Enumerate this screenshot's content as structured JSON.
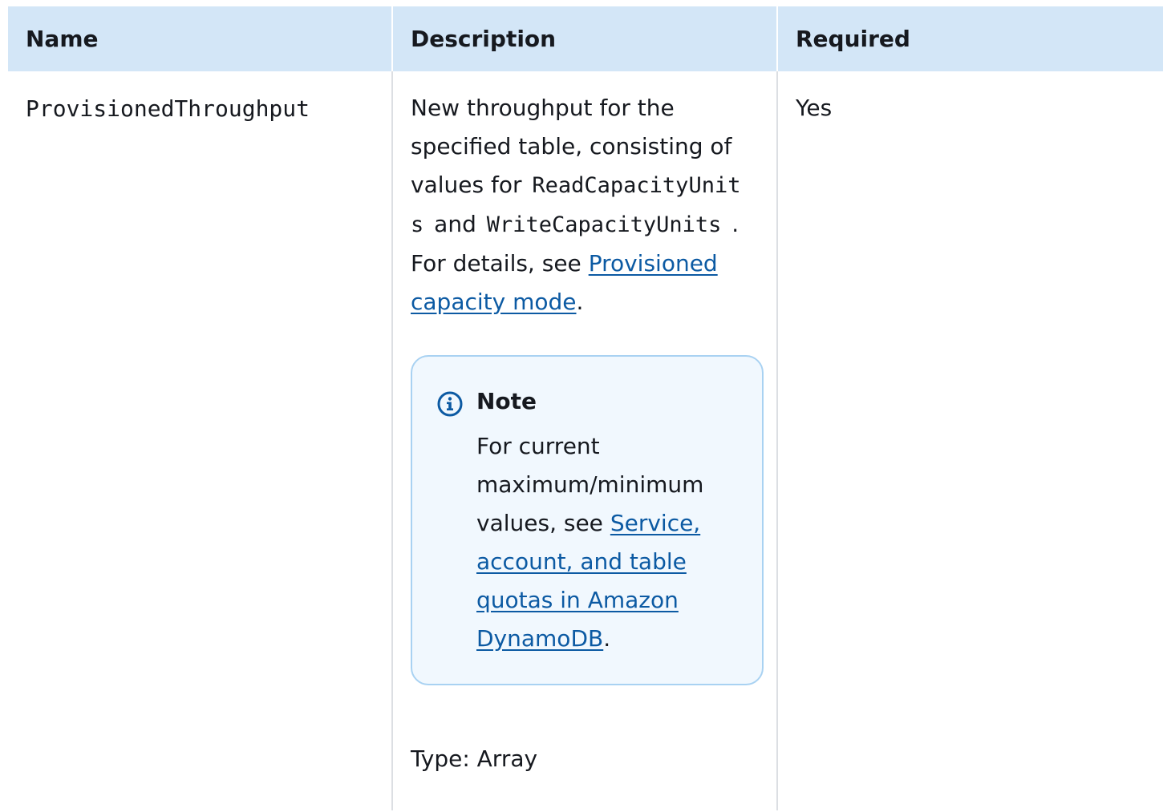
{
  "table": {
    "headers": {
      "name": "Name",
      "description": "Description",
      "required": "Required"
    },
    "row": {
      "name": "ProvisionedThroughput",
      "description": {
        "text1": "New throughput for the specified table, consisting of values for",
        "code1": "ReadCapacityUnits",
        "text2": "and",
        "code2": "WriteCapacityUnits",
        "text3": ". For details, see",
        "link1": "Provisioned capacity mode",
        "text4": "."
      },
      "note": {
        "icon": "info-icon",
        "title": "Note",
        "text1": "For current maximum/minimum values, see",
        "link": "Service, account, and table quotas in Amazon DynamoDB",
        "text2": "."
      },
      "type": "Type: Array",
      "required": "Yes"
    }
  },
  "colors": {
    "header_bg": "#d3e6f7",
    "link": "#0c5aa3",
    "note_bg": "#f1f8fe",
    "note_border": "#a9d2f2",
    "info_icon": "#0c5aa3"
  }
}
